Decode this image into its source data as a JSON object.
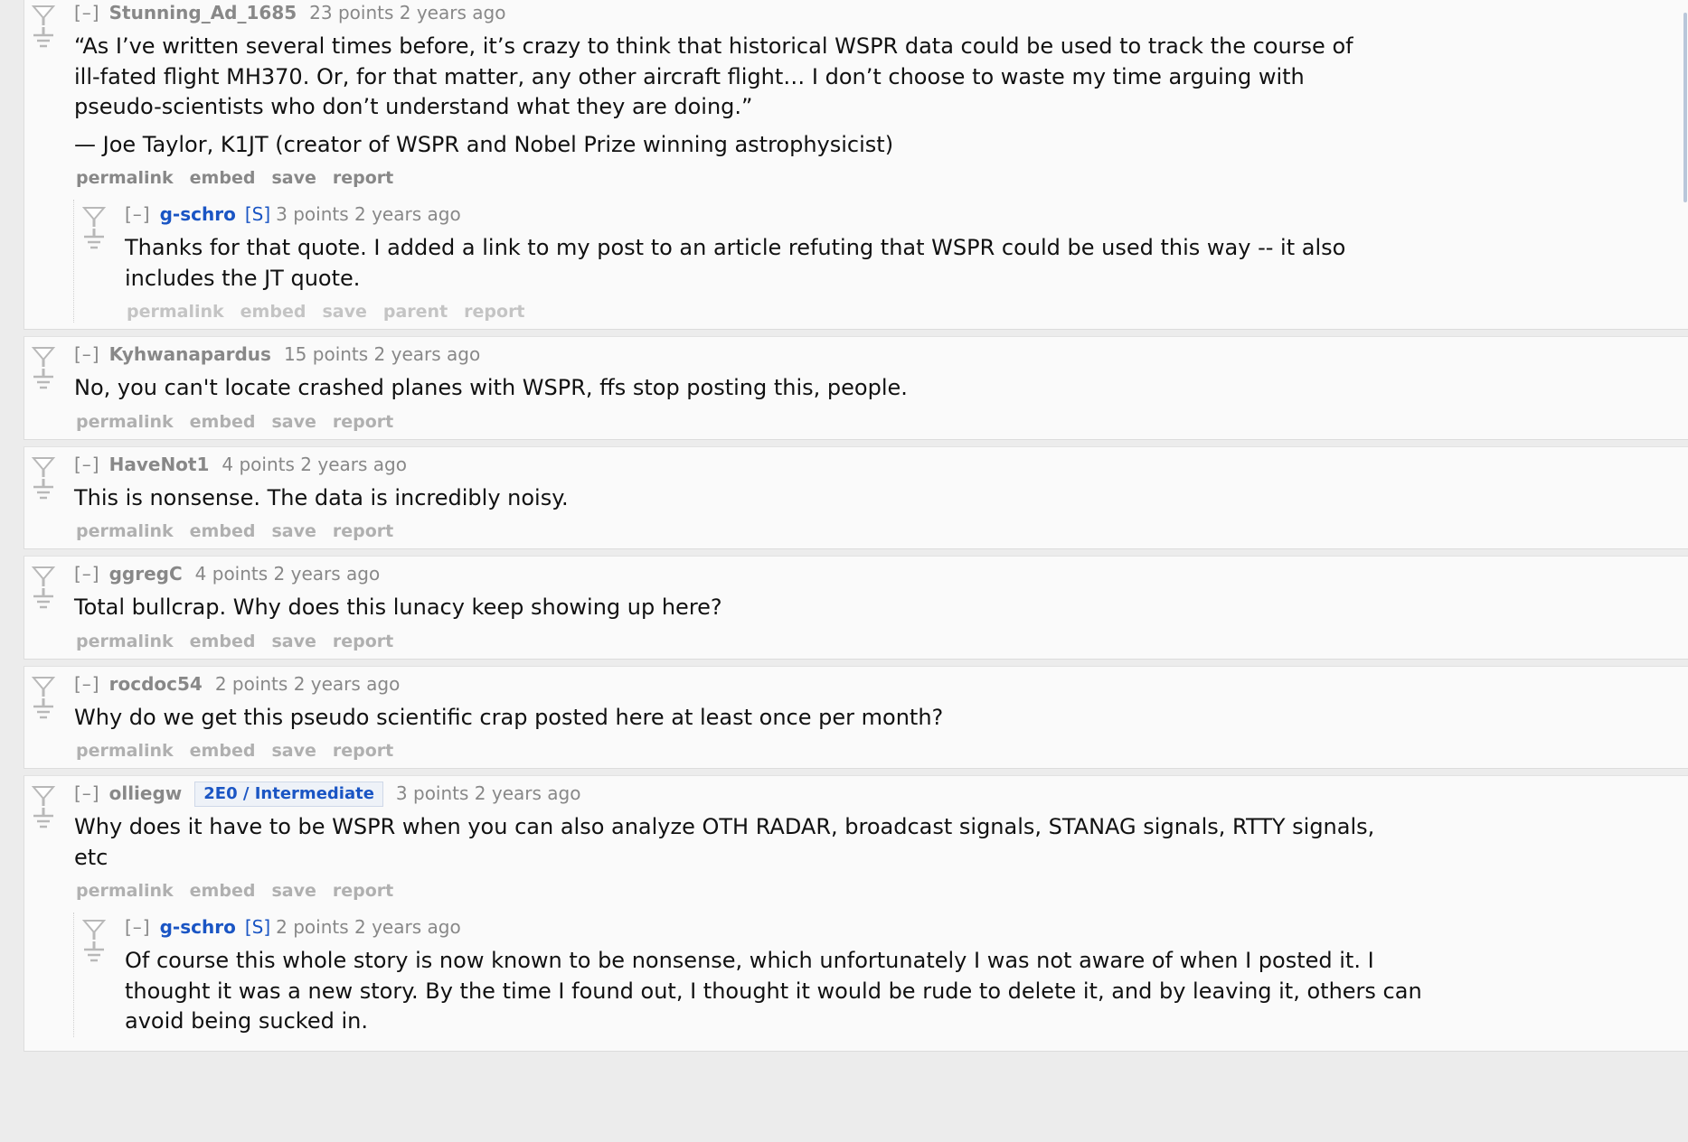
{
  "comments": [
    {
      "expand": "[–]",
      "author": "Stunning_Ad_1685",
      "score": "23 points",
      "time": "2 years ago",
      "paragraphs": [
        "“As I’ve written several times before, it’s crazy to think that historical WSPR data could be used to track the course of ill-fated flight MH370. Or, for that matter, any other aircraft flight… I don’t choose to waste my time arguing with pseudo-scientists who don’t understand what they are doing.”",
        "— Joe Taylor, K1JT (creator of WSPR and Nobel Prize winning astrophysicist)"
      ],
      "buttons": [
        "permalink",
        "embed",
        "save",
        "report"
      ],
      "reply": {
        "expand": "[–]",
        "author": "g-schro",
        "submitter": "[S]",
        "score": "3 points",
        "time": "2 years ago",
        "paragraphs": [
          "Thanks for that quote. I added a link to my post to an article refuting that WSPR could be used this way -- it also includes the JT quote."
        ],
        "buttons": [
          "permalink",
          "embed",
          "save",
          "parent",
          "report"
        ]
      }
    },
    {
      "expand": "[–]",
      "author": "Kyhwanapardus",
      "score": "15 points",
      "time": "2 years ago",
      "paragraphs": [
        "No, you can't locate crashed planes with WSPR, ffs stop posting this, people."
      ],
      "buttons": [
        "permalink",
        "embed",
        "save",
        "report"
      ]
    },
    {
      "expand": "[–]",
      "author": "HaveNot1",
      "score": "4 points",
      "time": "2 years ago",
      "paragraphs": [
        "This is nonsense. The data is incredibly noisy."
      ],
      "buttons": [
        "permalink",
        "embed",
        "save",
        "report"
      ]
    },
    {
      "expand": "[–]",
      "author": "ggregC",
      "score": "4 points",
      "time": "2 years ago",
      "paragraphs": [
        "Total bullcrap. Why does this lunacy keep showing up here?"
      ],
      "buttons": [
        "permalink",
        "embed",
        "save",
        "report"
      ]
    },
    {
      "expand": "[–]",
      "author": "rocdoc54",
      "score": "2 points",
      "time": "2 years ago",
      "paragraphs": [
        "Why do we get this pseudo scientific crap posted here at least once per month?"
      ],
      "buttons": [
        "permalink",
        "embed",
        "save",
        "report"
      ]
    },
    {
      "expand": "[–]",
      "author": "olliegw",
      "flair": "2E0 / Intermediate",
      "score": "3 points",
      "time": "2 years ago",
      "paragraphs": [
        "Why does it have to be WSPR when you can also analyze OTH RADAR, broadcast signals, STANAG signals, RTTY signals, etc"
      ],
      "buttons": [
        "permalink",
        "embed",
        "save",
        "report"
      ],
      "reply": {
        "expand": "[–]",
        "author": "g-schro",
        "submitter": "[S]",
        "score": "2 points",
        "time": "2 years ago",
        "paragraphs": [
          "Of course this whole story is now known to be nonsense, which unfortunately I was not aware of when I posted it. I thought it was a new story. By the time I found out, I thought it would be rude to delete it, and by leaving it, others can avoid being sucked in."
        ],
        "buttons": []
      }
    }
  ],
  "icons": {
    "upvote": "upvote-arrow-icon",
    "downvote": "downvote-arrow-icon"
  },
  "colors": {
    "op_author": "#1a55c4",
    "meta_gray": "#888888",
    "background": "#fafafa"
  }
}
